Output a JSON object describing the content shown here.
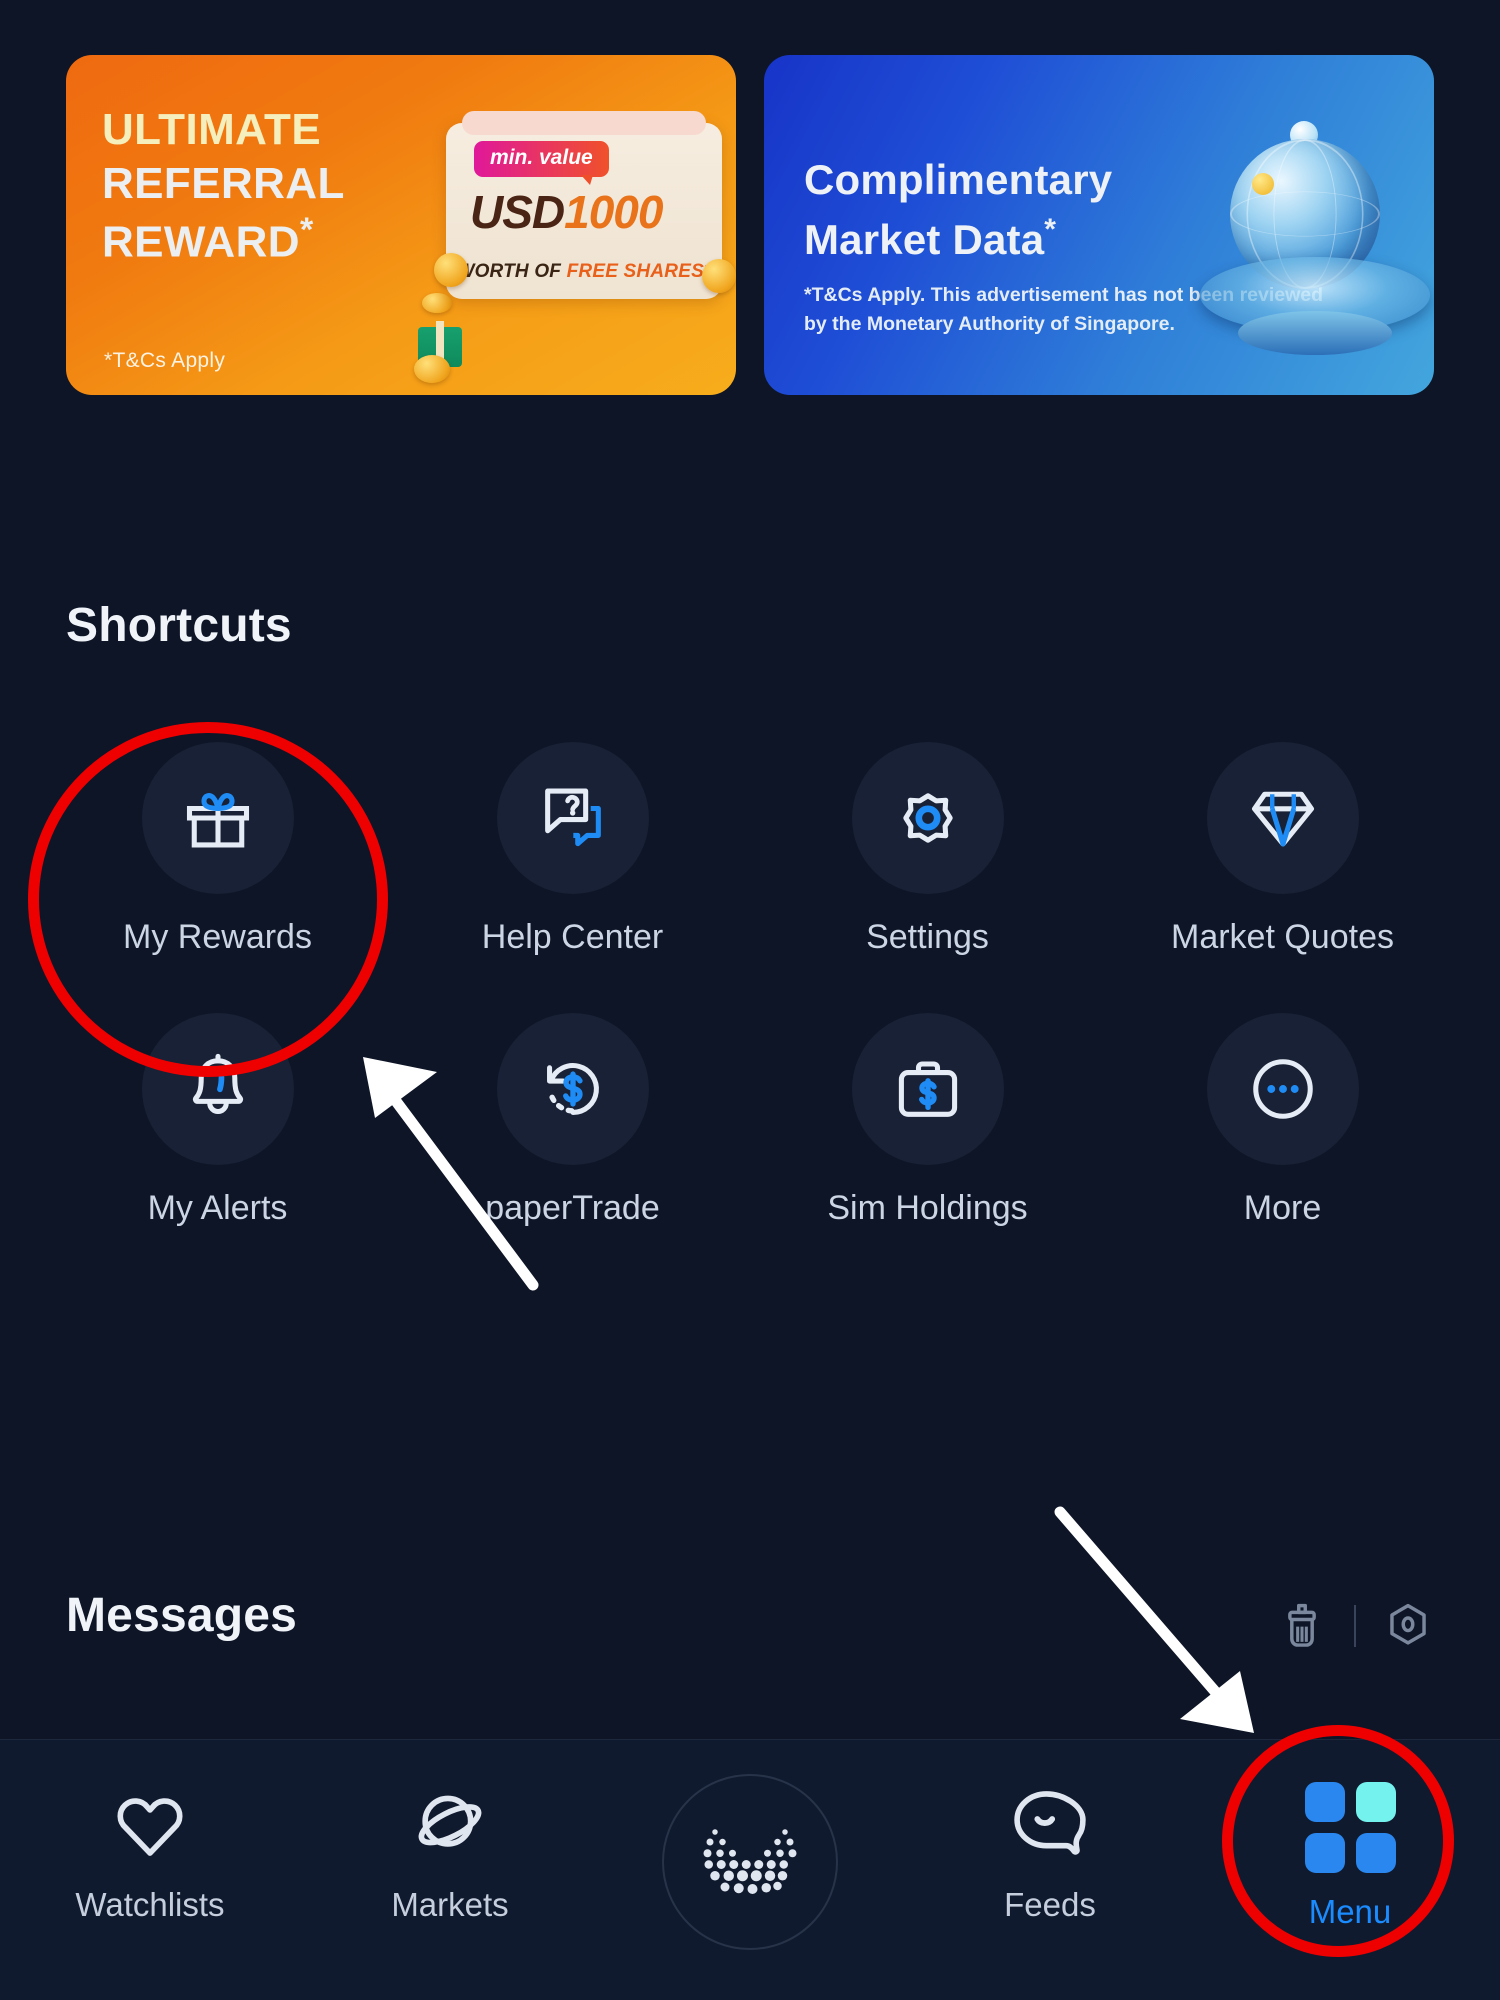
{
  "promos": [
    {
      "id": "ultimate-referral-reward",
      "line1": "ULTIMATE",
      "line2": "REFERRAL",
      "line3": "REWARD",
      "star": "*",
      "tcs": "*T&Cs Apply",
      "voucher": {
        "tag": "min. value",
        "amount_prefix": "USD",
        "amount_value": "1000",
        "worth_1": "WORTH OF ",
        "worth_2": "FREE SHARES",
        "worth_star": "*"
      }
    },
    {
      "id": "complimentary-market-data",
      "line1": "Complimentary",
      "line2": "Market Data",
      "star": "*",
      "fine_print": "*T&Cs Apply. This advertisement has not been reviewed by the Monetary Authority of Singapore."
    }
  ],
  "shortcuts": {
    "title": "Shortcuts",
    "items": [
      {
        "label": "My Rewards",
        "icon": "gift-icon"
      },
      {
        "label": "Help Center",
        "icon": "question-chat-icon"
      },
      {
        "label": "Settings",
        "icon": "gear-icon"
      },
      {
        "label": "Market Quotes",
        "icon": "diamond-icon"
      },
      {
        "label": "My Alerts",
        "icon": "bell-icon"
      },
      {
        "label": "paperTrade",
        "icon": "dollar-refresh-icon"
      },
      {
        "label": "Sim Holdings",
        "icon": "briefcase-dollar-icon"
      },
      {
        "label": "More",
        "icon": "ellipsis-circle-icon"
      }
    ]
  },
  "messages": {
    "title": "Messages",
    "actions": [
      {
        "icon": "broom-clean-icon"
      },
      {
        "icon": "settings-hex-icon"
      }
    ]
  },
  "bottom_nav": {
    "items": [
      {
        "label": "Watchlists",
        "icon": "heart-icon",
        "active": false
      },
      {
        "label": "Markets",
        "icon": "planet-icon",
        "active": false
      },
      {
        "label": "",
        "icon": "moomoo-dots-icon",
        "active": false
      },
      {
        "label": "Feeds",
        "icon": "speech-smile-icon",
        "active": false
      },
      {
        "label": "Menu",
        "icon": "grid-squares-icon",
        "active": true
      }
    ]
  },
  "annotations": {
    "highlight_color": "#ee0000",
    "arrow_color": "#ffffff",
    "targets": [
      "My Rewards",
      "Menu"
    ]
  },
  "colors": {
    "background": "#0d1527",
    "accent_blue": "#1a8cff",
    "promo_orange": "#f07a10",
    "promo_blue": "#1f4fd6"
  }
}
